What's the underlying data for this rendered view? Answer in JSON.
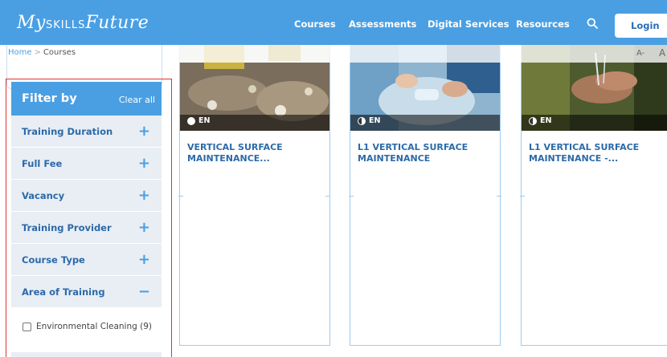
{
  "header": {
    "logo_main": "My",
    "logo_small": "SKILLS",
    "logo_tail": "Future",
    "nav": [
      "Courses",
      "Assessments",
      "Digital Services",
      "Resources"
    ],
    "search_icon": "search-icon",
    "login_label": "Login"
  },
  "breadcrumb": {
    "home": "Home",
    "separator": ">",
    "current": "Courses"
  },
  "font_size": {
    "decrease": "A-",
    "increase": "A"
  },
  "filter": {
    "title": "Filter by",
    "clear_label": "Clear all",
    "items": [
      {
        "label": "Training Duration",
        "sign": "+"
      },
      {
        "label": "Full Fee",
        "sign": "+"
      },
      {
        "label": "Vacancy",
        "sign": "+"
      },
      {
        "label": "Training Provider",
        "sign": "+"
      },
      {
        "label": "Course Type",
        "sign": "+"
      },
      {
        "label": "Area of Training",
        "sign": "−"
      }
    ],
    "options": [
      {
        "label": "Environmental Cleaning (9)",
        "checked": false
      }
    ]
  },
  "courses": [
    {
      "title": "VERTICAL SURFACE MAINTENANCE...",
      "lang": "EN",
      "lang_icon": "full-circle-icon"
    },
    {
      "title": "L1 VERTICAL SURFACE MAINTENANCE",
      "lang": "EN",
      "lang_icon": "half-circle-icon"
    },
    {
      "title": "L1 VERTICAL SURFACE MAINTENANCE -...",
      "lang": "EN",
      "lang_icon": "half-circle-icon"
    }
  ],
  "colors": {
    "brand": "#4a9fe3",
    "link": "#2c6aa8",
    "panel": "#e9eef4"
  }
}
